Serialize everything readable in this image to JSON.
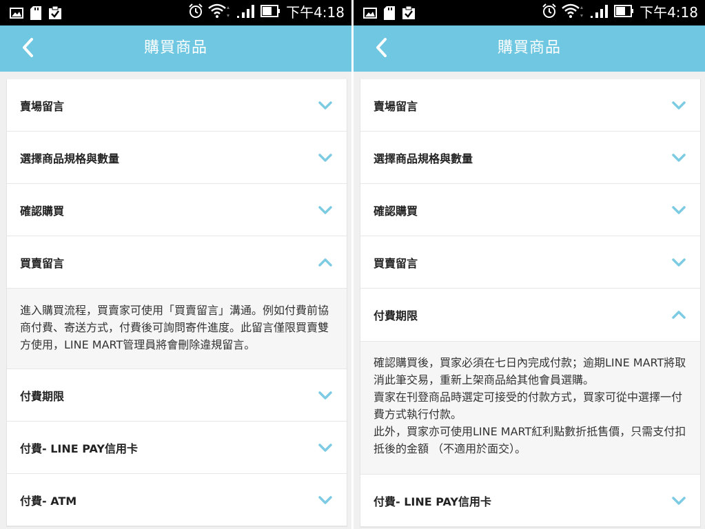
{
  "status_bar": {
    "time": "下午4:18",
    "left_icons": [
      "gallery-icon",
      "sd-card-icon",
      "clipboard-check-icon"
    ],
    "right_icons": [
      "alarm-icon",
      "wifi-icon",
      "signal-icon",
      "battery-icon"
    ]
  },
  "colors": {
    "accent": "#6fc7e1",
    "chevron": "#7ccbe3"
  },
  "left_screen": {
    "header": {
      "title": "購買商品"
    },
    "sections": [
      {
        "label": "賣場留言",
        "expanded": false
      },
      {
        "label": "選擇商品規格與數量",
        "expanded": false
      },
      {
        "label": "確認購買",
        "expanded": false
      },
      {
        "label": "買賣留言",
        "expanded": true
      },
      {
        "label": "付費期限",
        "expanded": false
      },
      {
        "label": "付費- LINE PAY信用卡",
        "expanded": false
      },
      {
        "label": "付費- ATM",
        "expanded": false
      }
    ],
    "expanded_content": {
      "text": "進入購買流程，買賣家可使用「買賣留言」溝通。例如付費前協商付費、寄送方式，付費後可詢問寄件進度。此留言僅限買賣雙方使用，LINE MART管理員將會刪除違規留言。"
    }
  },
  "right_screen": {
    "header": {
      "title": "購買商品"
    },
    "sections": [
      {
        "label": "賣場留言",
        "expanded": false
      },
      {
        "label": "選擇商品規格與數量",
        "expanded": false
      },
      {
        "label": "確認購買",
        "expanded": false
      },
      {
        "label": "買賣留言",
        "expanded": false
      },
      {
        "label": "付費期限",
        "expanded": true
      },
      {
        "label": "付費- LINE PAY信用卡",
        "expanded": false
      }
    ],
    "expanded_content": {
      "paragraph_1": "確認購買後，買家必須在七日內完成付款；逾期LINE MART將取消此筆交易，重新上架商品給其他會員選購。",
      "paragraph_2": "賣家在刊登商品時選定可接受的付款方式，買家可從中選擇一付費方式執行付款。",
      "paragraph_3": "此外，買家亦可使用LINE MART紅利點數折抵售價，只需支付扣抵後的金額 （不適用於面交）。"
    }
  }
}
